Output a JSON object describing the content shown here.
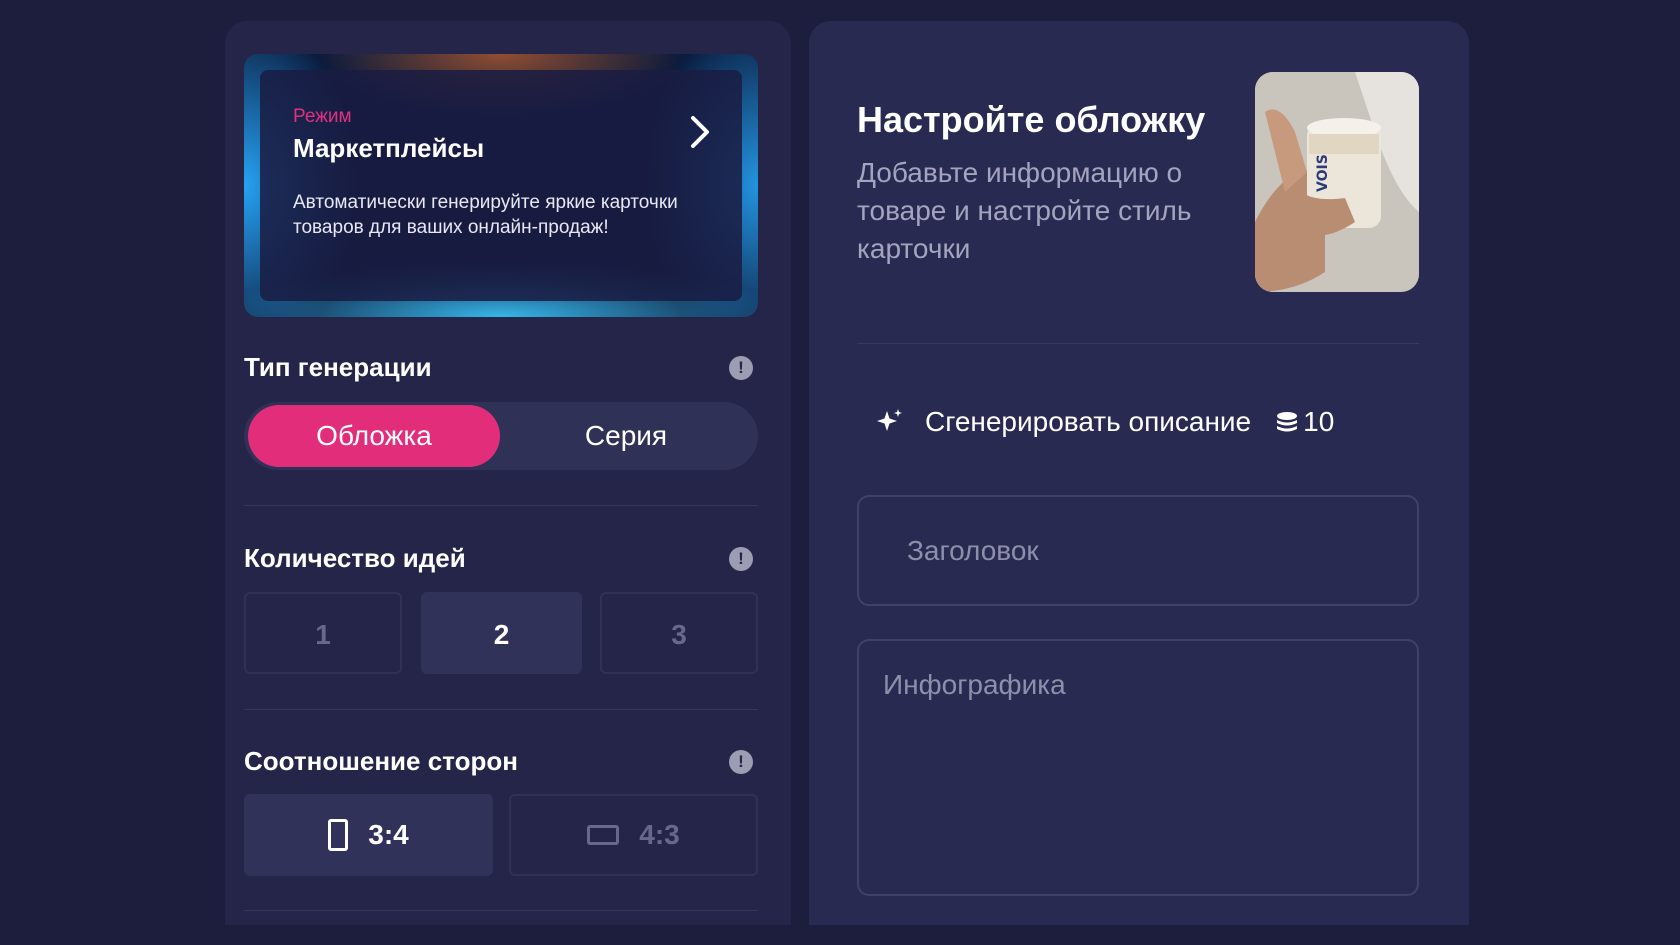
{
  "mode_card": {
    "label": "Режим",
    "title": "Маркетплейсы",
    "description": "Автоматически генерируйте яркие карточки товаров для ваших онлайн-продаж!"
  },
  "generation_type": {
    "title": "Тип генерации",
    "info": "!",
    "options": [
      "Обложка",
      "Серия"
    ],
    "selected": "Обложка"
  },
  "ideas_count": {
    "title": "Количество идей",
    "info": "!",
    "options": [
      "1",
      "2",
      "3"
    ],
    "selected": "2"
  },
  "aspect_ratio": {
    "title": "Соотношение сторон",
    "info": "!",
    "options": [
      "3:4",
      "4:3"
    ],
    "selected": "3:4"
  },
  "cover": {
    "title": "Настройте обложку",
    "subtitle": "Добавьте информацию о товаре и настройте стиль карточки"
  },
  "generate_description": {
    "label": "Сгенерировать описание",
    "cost": "10"
  },
  "fields": {
    "title_placeholder": "Заголовок",
    "infographic_placeholder": "Инфографика"
  },
  "product_image": {
    "brand_text": "VOIS"
  },
  "colors": {
    "accent": "#e22d7b",
    "background": "#1d1d3d",
    "panel": "#25254a",
    "panel_right": "#292a52"
  }
}
